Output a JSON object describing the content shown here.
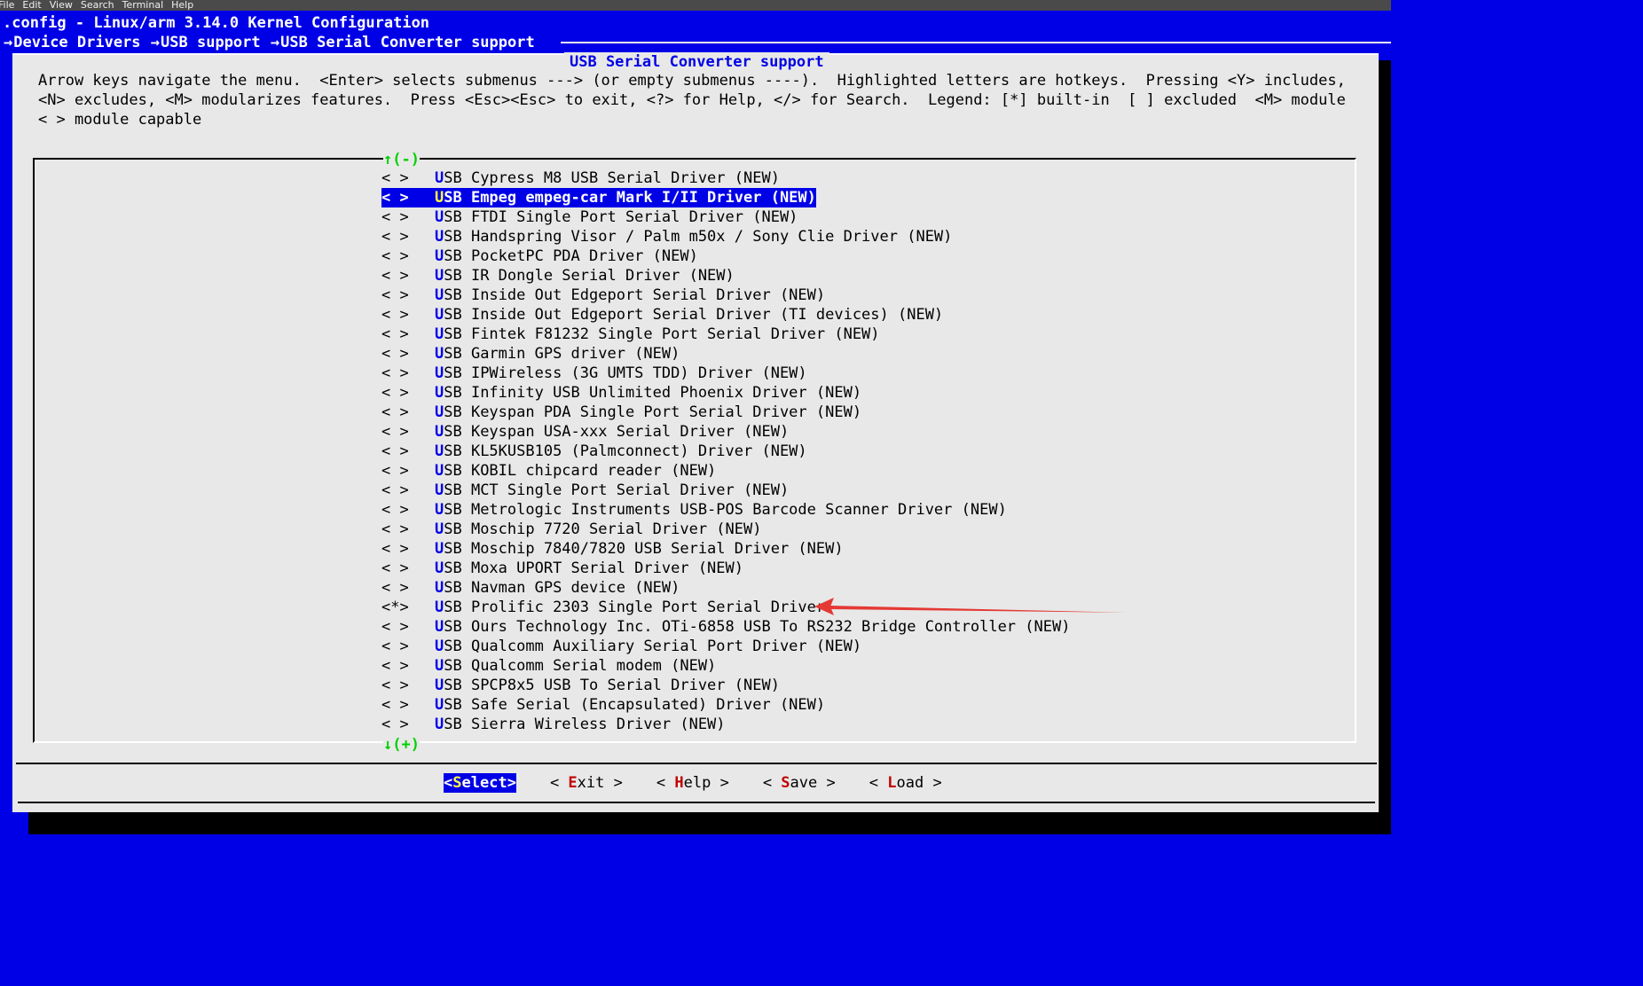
{
  "terminal_menu": [
    "File",
    "Edit",
    "View",
    "Search",
    "Terminal",
    "Help"
  ],
  "window_title": ".config - Linux/arm 3.14.0 Kernel Configuration",
  "breadcrumb": [
    "Device Drivers",
    "USB support",
    "USB Serial Converter support"
  ],
  "breadcrumb_separator": "→",
  "dialog_title": "USB Serial Converter support",
  "help_text": "Arrow keys navigate the menu.  <Enter> selects submenus ---> (or empty submenus ----).  Highlighted letters are hotkeys.  Pressing <Y> includes,\n<N> excludes, <M> modularizes features.  Press <Esc><Esc> to exit, <?> for Help, </> for Search.  Legend: [*] built-in  [ ] excluded  <M> module\n< > module capable",
  "scroll_up_indicator": "↑(-)",
  "scroll_down_indicator": "↓(+)",
  "items": [
    {
      "state": "< >",
      "hotkey": "U",
      "label": "SB Cypress M8 USB Serial Driver (NEW)",
      "selected": false
    },
    {
      "state": "< >",
      "hotkey": "U",
      "label": "SB Empeg empeg-car Mark I/II Driver (NEW)",
      "selected": true
    },
    {
      "state": "< >",
      "hotkey": "U",
      "label": "SB FTDI Single Port Serial Driver (NEW)",
      "selected": false
    },
    {
      "state": "< >",
      "hotkey": "U",
      "label": "SB Handspring Visor / Palm m50x / Sony Clie Driver (NEW)",
      "selected": false
    },
    {
      "state": "< >",
      "hotkey": "U",
      "label": "SB PocketPC PDA Driver (NEW)",
      "selected": false
    },
    {
      "state": "< >",
      "hotkey": "U",
      "label": "SB IR Dongle Serial Driver (NEW)",
      "selected": false
    },
    {
      "state": "< >",
      "hotkey": "U",
      "label": "SB Inside Out Edgeport Serial Driver (NEW)",
      "selected": false
    },
    {
      "state": "< >",
      "hotkey": "U",
      "label": "SB Inside Out Edgeport Serial Driver (TI devices) (NEW)",
      "selected": false
    },
    {
      "state": "< >",
      "hotkey": "U",
      "label": "SB Fintek F81232 Single Port Serial Driver (NEW)",
      "selected": false
    },
    {
      "state": "< >",
      "hotkey": "U",
      "label": "SB Garmin GPS driver (NEW)",
      "selected": false
    },
    {
      "state": "< >",
      "hotkey": "U",
      "label": "SB IPWireless (3G UMTS TDD) Driver (NEW)",
      "selected": false
    },
    {
      "state": "< >",
      "hotkey": "U",
      "label": "SB Infinity USB Unlimited Phoenix Driver (NEW)",
      "selected": false
    },
    {
      "state": "< >",
      "hotkey": "U",
      "label": "SB Keyspan PDA Single Port Serial Driver (NEW)",
      "selected": false
    },
    {
      "state": "< >",
      "hotkey": "U",
      "label": "SB Keyspan USA-xxx Serial Driver (NEW)",
      "selected": false
    },
    {
      "state": "< >",
      "hotkey": "U",
      "label": "SB KL5KUSB105 (Palmconnect) Driver (NEW)",
      "selected": false
    },
    {
      "state": "< >",
      "hotkey": "U",
      "label": "SB KOBIL chipcard reader (NEW)",
      "selected": false
    },
    {
      "state": "< >",
      "hotkey": "U",
      "label": "SB MCT Single Port Serial Driver (NEW)",
      "selected": false
    },
    {
      "state": "< >",
      "hotkey": "U",
      "label": "SB Metrologic Instruments USB-POS Barcode Scanner Driver (NEW)",
      "selected": false
    },
    {
      "state": "< >",
      "hotkey": "U",
      "label": "SB Moschip 7720 Serial Driver (NEW)",
      "selected": false
    },
    {
      "state": "< >",
      "hotkey": "U",
      "label": "SB Moschip 7840/7820 USB Serial Driver (NEW)",
      "selected": false
    },
    {
      "state": "< >",
      "hotkey": "U",
      "label": "SB Moxa UPORT Serial Driver (NEW)",
      "selected": false
    },
    {
      "state": "< >",
      "hotkey": "U",
      "label": "SB Navman GPS device (NEW)",
      "selected": false
    },
    {
      "state": "<*>",
      "hotkey": "U",
      "label": "SB Prolific 2303 Single Port Serial Driver",
      "selected": false
    },
    {
      "state": "< >",
      "hotkey": "U",
      "label": "SB Ours Technology Inc. OTi-6858 USB To RS232 Bridge Controller (NEW)",
      "selected": false
    },
    {
      "state": "< >",
      "hotkey": "U",
      "label": "SB Qualcomm Auxiliary Serial Port Driver (NEW)",
      "selected": false
    },
    {
      "state": "< >",
      "hotkey": "U",
      "label": "SB Qualcomm Serial modem (NEW)",
      "selected": false
    },
    {
      "state": "< >",
      "hotkey": "U",
      "label": "SB SPCP8x5 USB To Serial Driver (NEW)",
      "selected": false
    },
    {
      "state": "< >",
      "hotkey": "U",
      "label": "SB Safe Serial (Encapsulated) Driver (NEW)",
      "selected": false
    },
    {
      "state": "< >",
      "hotkey": "U",
      "label": "SB Sierra Wireless Driver (NEW)",
      "selected": false
    }
  ],
  "buttons": [
    {
      "name": "select",
      "pre": "<",
      "hotkey": "S",
      "rest": "elect",
      "post": ">",
      "active": true
    },
    {
      "name": "exit",
      "pre": "< ",
      "hotkey": "E",
      "rest": "xit",
      "post": " >",
      "active": false
    },
    {
      "name": "help",
      "pre": "< ",
      "hotkey": "H",
      "rest": "elp",
      "post": " >",
      "active": false
    },
    {
      "name": "save",
      "pre": "< ",
      "hotkey": "S",
      "rest": "ave",
      "post": " >",
      "active": false
    },
    {
      "name": "load",
      "pre": "< ",
      "hotkey": "L",
      "rest": "oad",
      "post": " >",
      "active": false
    }
  ],
  "colors": {
    "terminal_bg": "#0000e6",
    "dialog_bg": "#e8e8e8",
    "hotkey": "#0000e6",
    "selected_bg": "#0000e6",
    "button_hotkey": "#c00000",
    "scroll_indicator": "#00d000",
    "annotation_arrow": "#e53935"
  },
  "annotation": {
    "type": "arrow",
    "points_to": "SB Prolific 2303 Single Port Serial Driver"
  }
}
